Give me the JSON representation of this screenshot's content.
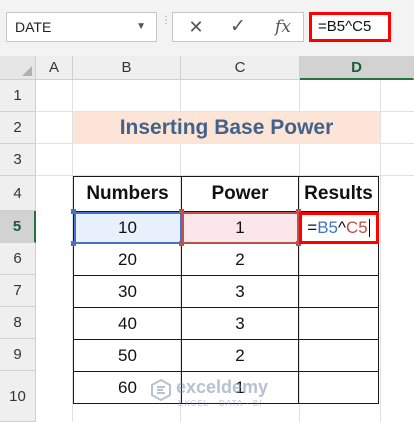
{
  "formula_bar": {
    "name_box_value": "DATE",
    "cancel_icon": "✕",
    "enter_icon": "✓",
    "fx_label": "fx",
    "formula": "=B5^C5"
  },
  "columns": [
    "A",
    "B",
    "C",
    "D"
  ],
  "selected_column": "D",
  "rows": [
    "1",
    "2",
    "3",
    "4",
    "5",
    "6",
    "7",
    "8",
    "9",
    "10"
  ],
  "selected_row": "5",
  "title": "Inserting Base Power",
  "table": {
    "headers": [
      "Numbers",
      "Power",
      "Results"
    ],
    "rows": [
      [
        "10",
        "1"
      ],
      [
        "20",
        "2"
      ],
      [
        "30",
        "3"
      ],
      [
        "40",
        "3"
      ],
      [
        "50",
        "2"
      ],
      [
        "60",
        "1"
      ]
    ]
  },
  "edit_cell": {
    "equals": "=",
    "ref_base": "B5",
    "op": "^",
    "ref_power": "C5"
  },
  "colors": {
    "accent_red": "#ff0000",
    "ref_blue": "#4472c4",
    "ref_red": "#c0504d",
    "title_fill": "#fce4d6",
    "title_text": "#43628a",
    "excel_green": "#217346"
  },
  "watermark": {
    "brand": "exceldemy",
    "tagline": "EXCEL · DATA · BI"
  }
}
